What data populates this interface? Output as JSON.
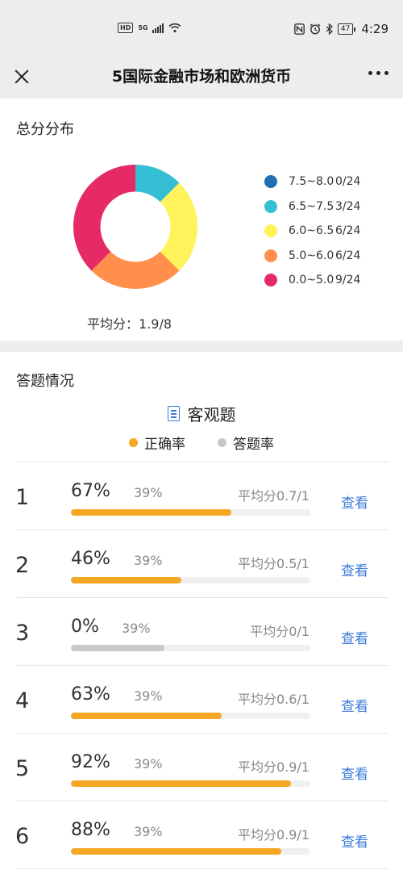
{
  "status": {
    "network": "5G",
    "hd": "HD",
    "battery": "47",
    "time": "4:29"
  },
  "nav": {
    "title": "5国际金融市场和欧洲货币"
  },
  "distribution": {
    "title": "总分分布",
    "legend": [
      {
        "range": "7.5~8.0",
        "count": "0/24",
        "value": 0,
        "color": "#1f6fb2"
      },
      {
        "range": "6.5~7.5",
        "count": "3/24",
        "value": 3,
        "color": "#35bfd4"
      },
      {
        "range": "6.0~6.5",
        "count": "6/24",
        "value": 6,
        "color": "#fff35c"
      },
      {
        "range": "5.0~6.0",
        "count": "6/24",
        "value": 6,
        "color": "#ff8f4a"
      },
      {
        "range": "0.0~5.0",
        "count": "9/24",
        "value": 9,
        "color": "#e62a63"
      }
    ],
    "avg_label": "平均分：",
    "avg_value": "1.9/8"
  },
  "answers": {
    "title": "答题情况",
    "objective_label": "客观题",
    "legend_correct": "正确率",
    "legend_answer": "答题率",
    "correct_color": "#f5a623",
    "answer_color": "#c8c8c8",
    "view_label": "查看",
    "questions": [
      {
        "num": "1",
        "rate": "67%",
        "rate_value": 0.67,
        "answer": "39%",
        "answer_value": 0.39,
        "avg": "平均分0.7/1"
      },
      {
        "num": "2",
        "rate": "46%",
        "rate_value": 0.46,
        "answer": "39%",
        "answer_value": 0.39,
        "avg": "平均分0.5/1"
      },
      {
        "num": "3",
        "rate": "0%",
        "rate_value": 0.0,
        "answer": "39%",
        "answer_value": 0.39,
        "avg": "平均分0/1"
      },
      {
        "num": "4",
        "rate": "63%",
        "rate_value": 0.63,
        "answer": "39%",
        "answer_value": 0.39,
        "avg": "平均分0.6/1"
      },
      {
        "num": "5",
        "rate": "92%",
        "rate_value": 0.92,
        "answer": "39%",
        "answer_value": 0.39,
        "avg": "平均分0.9/1"
      },
      {
        "num": "6",
        "rate": "88%",
        "rate_value": 0.88,
        "answer": "39%",
        "answer_value": 0.39,
        "avg": "平均分0.9/1"
      }
    ]
  }
}
